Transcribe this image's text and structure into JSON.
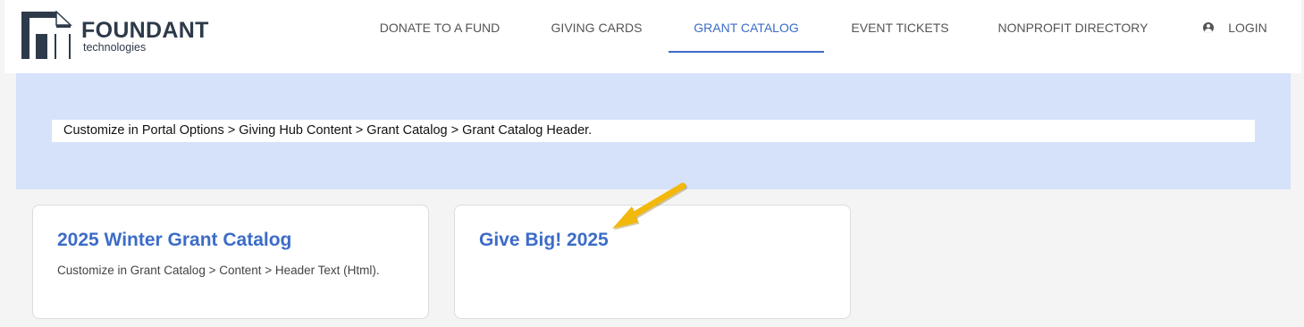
{
  "brand": {
    "name": "FOUNDANT",
    "subtitle": "technologies",
    "logo_icon": "foundant-logo-icon"
  },
  "nav": {
    "items": [
      {
        "label": "DONATE TO A FUND",
        "active": false
      },
      {
        "label": "GIVING CARDS",
        "active": false
      },
      {
        "label": "GRANT CATALOG",
        "active": true
      },
      {
        "label": "EVENT TICKETS",
        "active": false
      },
      {
        "label": "NONPROFIT DIRECTORY",
        "active": false
      }
    ],
    "login": {
      "label": "LOGIN",
      "icon": "user-circle-icon"
    }
  },
  "hero": {
    "text": "Customize in Portal Options > Giving Hub Content > Grant Catalog > Grant Catalog Header."
  },
  "catalogs": [
    {
      "title": "2025 Winter Grant Catalog",
      "description": "Customize in Grant Catalog > Content > Header Text (Html)."
    },
    {
      "title": "Give Big! 2025",
      "description": ""
    }
  ],
  "annotation": {
    "icon": "arrow-annotation-icon"
  },
  "colors": {
    "accent": "#3c6cc7",
    "hero_bg": "#d6e2fa",
    "page_bg": "#f4f4f4",
    "annotation_arrow": "#f2b80c"
  }
}
